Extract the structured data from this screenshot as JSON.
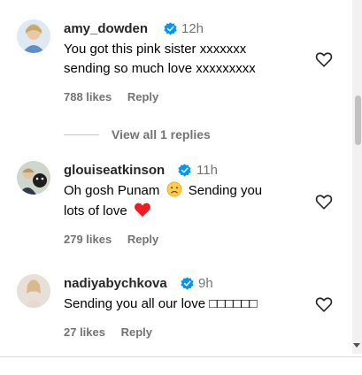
{
  "comments": [
    {
      "username": "amy_dowden",
      "time": "12h",
      "lines": [
        "You got this pink sister xxxxxxx",
        "sending so much love xxxxxxxxx"
      ],
      "likes": "788 likes",
      "reply": "Reply"
    },
    {
      "username": "glouiseatkinson",
      "time": "11h",
      "line1_before": "Oh gosh Punam",
      "line1_after": "Sending you",
      "line2": "lots of love",
      "likes": "279 likes",
      "reply": "Reply"
    },
    {
      "username": "nadiyabychkova",
      "time": "9h",
      "lines": [
        "Sending you all our love □□□□□□"
      ],
      "likes": "27 likes",
      "reply": "Reply"
    }
  ],
  "view_replies": "View all 1 replies",
  "colors": {
    "verified": "#0095f6",
    "secondary": "#737373",
    "heart_red": "#ed1b24"
  },
  "icons": [
    "verified-badge-icon",
    "heart-outline-icon",
    "sad-face-emoji",
    "red-heart-emoji"
  ]
}
